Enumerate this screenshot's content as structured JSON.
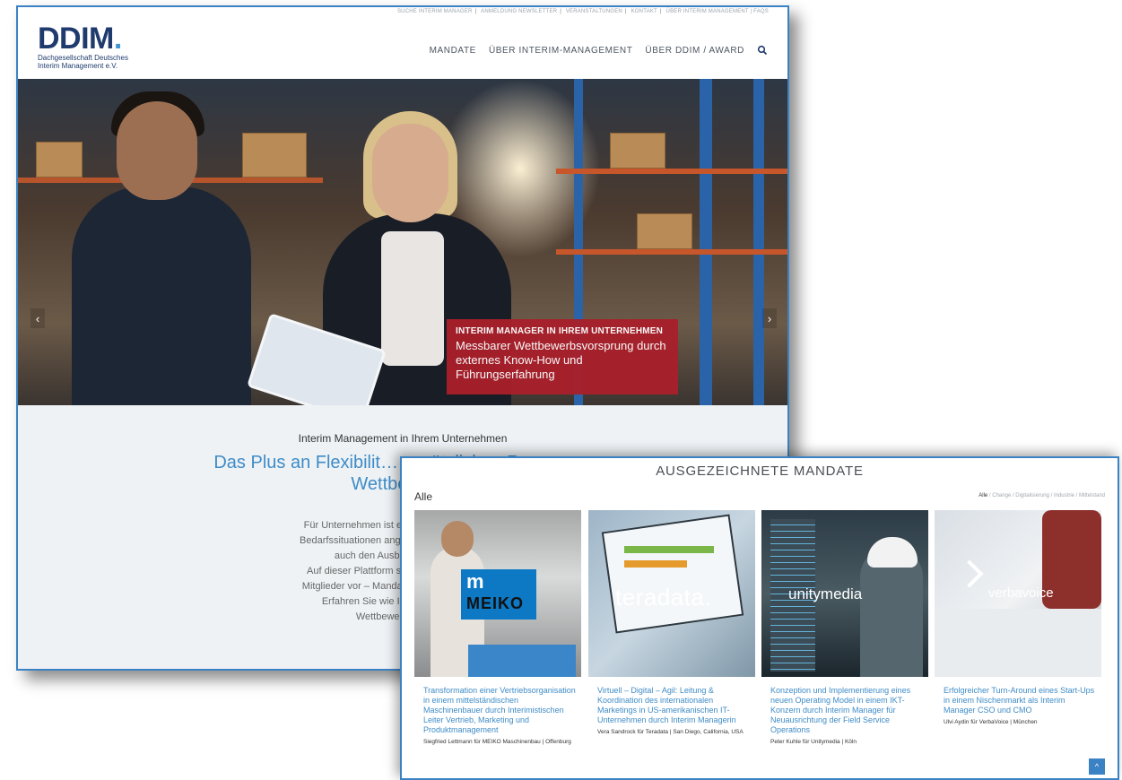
{
  "back_window": {
    "top_links": [
      "SUCHE INTERIM MANAGER",
      "ANMELDUNG NEWSLETTER",
      "VERANSTALTUNGEN",
      "KONTAKT",
      "ÜBER INTERIM MANAGEMENT | FAQS"
    ],
    "logo": {
      "mark": "DDIM",
      "dot": ".",
      "subtitle_line1": "Dachgesellschaft Deutsches",
      "subtitle_line2": "Interim Management e.V."
    },
    "nav": [
      "MANDATE",
      "ÜBER INTERIM-MANAGEMENT",
      "ÜBER DDIM / AWARD"
    ],
    "hero": {
      "caption_title": "INTERIM MANAGER IN IHREM UNTERNEHMEN",
      "caption_text": "Messbarer Wettbewerbsvorsprung durch externes Know-How und Führungserfahrung",
      "arrow_left": "‹",
      "arrow_right": "›"
    },
    "intro": {
      "kicker": "Interim Management in Ihrem Unternehmen",
      "headline": "Das Plus an Flexibilit… zusätzlichen Ressour… Wettbewer…",
      "body_lines": [
        "Für Unternehmen ist es wichtig, dass Struk…",
        "Bedarfssituationen angepasst werden. Das g…",
        "auch den Ausbau von Fachw…",
        "Auf dieser Plattform stellen wir Ihnen eine…",
        "Mitglieder vor – Mandate die einen hohen N…",
        "Erfahren Sie wie Interim Managem…",
        "Wettbewerbsfähigk…"
      ]
    }
  },
  "front_window": {
    "section_title": "AUSGEZEICHNETE MANDATE",
    "filter_current": "Alle",
    "filter_links": {
      "active": "Alle",
      "rest": " / Change / Digitalisierung / Industrie / Mittelstand"
    },
    "cards": [
      {
        "logo": "MEIKO",
        "title": "Transformation einer Vertriebsorganisation in einem mittelständischen Maschinenbauer durch Interimistischen Leiter Vertrieb, Marketing und Produktmanagement",
        "meta": "Siegfried Lettmann für MEIKO Maschinenbau | Offenburg"
      },
      {
        "logo": "teradata.",
        "title": "Virtuell – Digital – Agil: Leitung & Koordination des internationalen Marketings in US-amerikanischen IT-Unternehmen durch Interim Managerin",
        "meta": "Vera Sandrock für Teradata | San Diego, California, USA"
      },
      {
        "logo": "unitymedia",
        "title": "Konzeption und Implementierung eines neuen Operating Model in einem IKT-Konzern durch Interim Manager für Neuausrichtung der Field Service Operations",
        "meta": "Peter Kuhle für Unitymedia | Köln"
      },
      {
        "logo": "verbavoice",
        "title": "Erfolgreicher Turn-Around eines Start-Ups in einem Nischenmarkt als Interim Manager CSO und CMO",
        "meta": "Ulvi Aydin für VerbaVoice | München"
      }
    ],
    "to_top": "^"
  }
}
